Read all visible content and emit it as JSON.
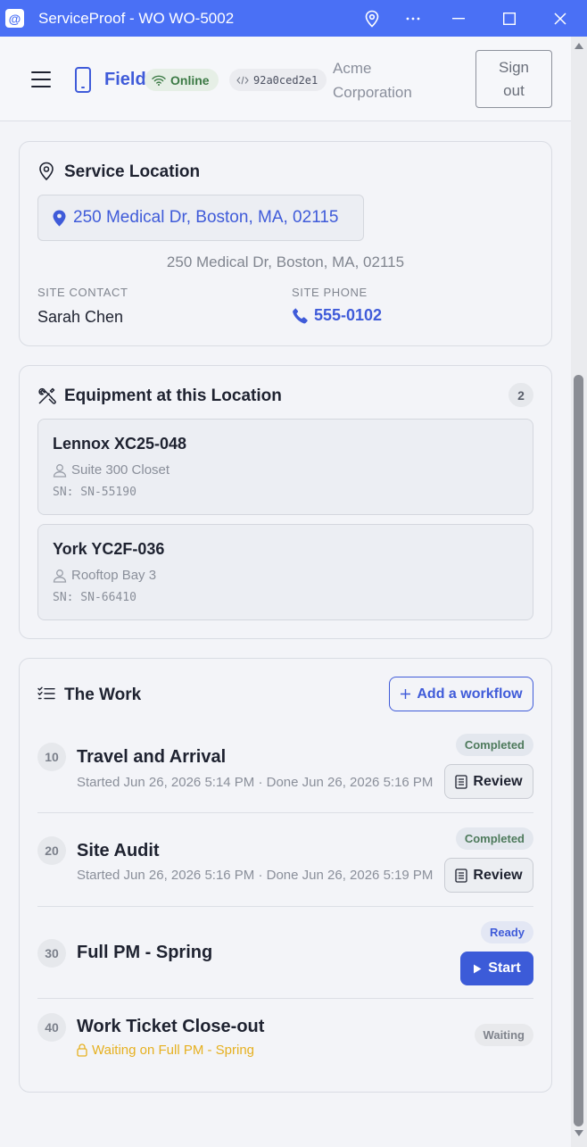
{
  "window": {
    "title": "ServiceProof - WO WO-5002",
    "app_icon": "@",
    "controls": [
      "location-icon",
      "more-icon",
      "minimize-icon",
      "maximize-icon",
      "close-icon"
    ]
  },
  "header": {
    "brand": "Field",
    "online_label": "Online",
    "commit": "92a0ced2e1",
    "org_line1": "Acme",
    "org_line2": "Corporation",
    "signout_line1": "Sign",
    "signout_line2": "out"
  },
  "service_location": {
    "title": "Service Location",
    "address_button": "250 Medical Dr, Boston, MA, 02115",
    "address_text": "250 Medical Dr, Boston, MA, 02115",
    "contact_label": "SITE CONTACT",
    "contact_value": "Sarah Chen",
    "phone_label": "SITE PHONE",
    "phone_value": "555-0102"
  },
  "equipment": {
    "title": "Equipment at this Location",
    "count": "2",
    "items": [
      {
        "name": "Lennox XC25-048",
        "location": "Suite 300 Closet",
        "serial": "SN: SN-55190"
      },
      {
        "name": "York YC2F-036",
        "location": "Rooftop Bay 3",
        "serial": "SN: SN-66410"
      }
    ]
  },
  "work": {
    "title": "The Work",
    "add_label": "Add a workflow",
    "review_label": "Review",
    "start_label": "Start",
    "items": [
      {
        "num": "10",
        "title": "Travel and Arrival",
        "subtitle": "Started Jun 26, 2026 5:14 PM · Done Jun 26, 2026 5:16 PM",
        "status": "Completed"
      },
      {
        "num": "20",
        "title": "Site Audit",
        "subtitle": "Started Jun 26, 2026 5:16 PM · Done Jun 26, 2026 5:19 PM",
        "status": "Completed"
      },
      {
        "num": "30",
        "title": "Full PM - Spring",
        "subtitle": "",
        "status": "Ready"
      },
      {
        "num": "40",
        "title": "Work Ticket Close-out",
        "subtitle": "Waiting on Full PM - Spring",
        "status": "Waiting"
      }
    ]
  },
  "colors": {
    "titlebar": "#4a70f5",
    "accent": "#3f5bd9",
    "online_green": "#3c7a45",
    "waiting_amber": "#e6b020"
  }
}
